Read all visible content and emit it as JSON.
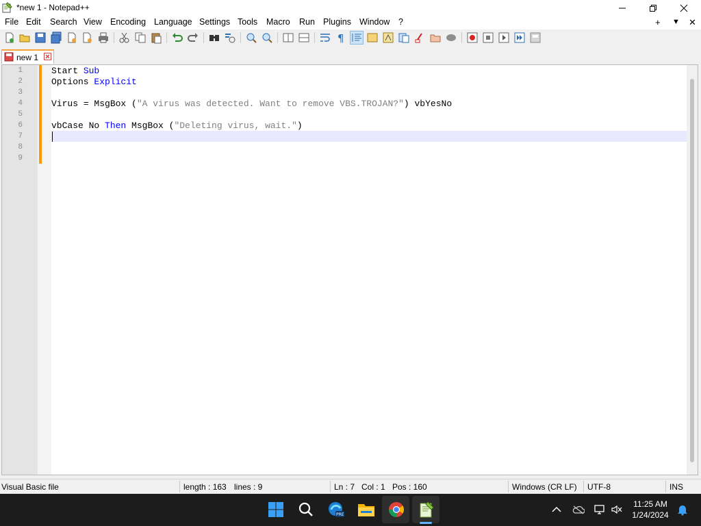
{
  "window": {
    "title": "*new 1 - Notepad++",
    "minimize_icon": "minimize-icon",
    "restore_icon": "restore-icon",
    "close_icon": "close-icon"
  },
  "menu": {
    "items": [
      "File",
      "Edit",
      "Search",
      "View",
      "Encoding",
      "Language",
      "Settings",
      "Tools",
      "Macro",
      "Run",
      "Plugins",
      "Window",
      "?"
    ],
    "right_controls": [
      "+",
      "▼",
      "✕"
    ]
  },
  "tab": {
    "label": "new 1",
    "icon": "unsaved-file-icon"
  },
  "editor": {
    "line_numbers": [
      "1",
      "2",
      "3",
      "4",
      "5",
      "6",
      "7",
      "8",
      "9"
    ],
    "lines": [
      {
        "plain": "Start ",
        "kw": "Sub"
      },
      {
        "plain": "Options ",
        "kw": "Explicit"
      },
      {
        "plain": ""
      },
      {
        "pre": "Virus = MsgBox (",
        "str": "\"A virus was detected. Want to remove VBS.TROJAN?\"",
        "post": ") vbYesNo"
      },
      {
        "plain": ""
      },
      {
        "pre": "vbCase No ",
        "kw": "Then",
        "mid": " MsgBox (",
        "str": "\"Deleting virus, wait.\"",
        "post": ")"
      },
      {
        "plain": ""
      },
      {
        "plain": ""
      },
      {
        "plain": ""
      }
    ],
    "colors": {
      "keyword": "#0000ff",
      "string": "#808080",
      "current_line": "#e8e8ff",
      "changed_marker": "#ff9a00"
    }
  },
  "status": {
    "file_type": "Visual Basic file",
    "length": "length : 163",
    "lines": "lines : 9",
    "ln": "Ln : 7",
    "col": "Col : 1",
    "pos": "Pos : 160",
    "eol": "Windows (CR LF)",
    "encoding": "UTF-8",
    "mode": "INS"
  },
  "taskbar": {
    "apps": [
      "start-icon",
      "search-icon",
      "edge-beta-icon",
      "file-explorer-icon",
      "chrome-icon",
      "notepadpp-icon"
    ],
    "time": "11:25 AM",
    "date": "1/24/2024",
    "tray": [
      "chevron-up-icon",
      "onedrive-icon",
      "network-icon",
      "volume-icon",
      "notification-bell-icon"
    ]
  }
}
